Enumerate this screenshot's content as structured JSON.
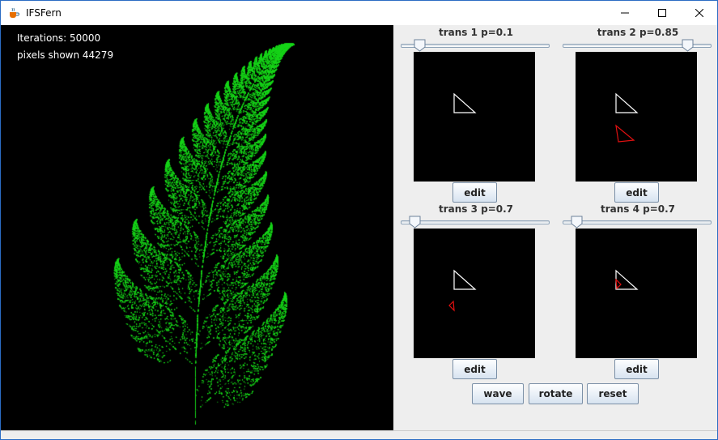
{
  "window": {
    "title": "IFSFern",
    "controls": {
      "minimize_icon": "minimize-icon",
      "maximize_icon": "maximize-icon",
      "close_icon": "close-icon"
    }
  },
  "canvas": {
    "iterations_text": "Iterations: 50000",
    "pixels_text": "pixels shown 44279",
    "fern_color": "#18d41a",
    "background": "#000000"
  },
  "transforms": [
    {
      "label": "trans 1 p=0.1",
      "slider_value": 0.1,
      "edit_label": "edit"
    },
    {
      "label": "trans 2 p=0.85",
      "slider_value": 0.85,
      "edit_label": "edit"
    },
    {
      "label": "trans 3 p=0.7",
      "slider_value": 0.07,
      "edit_label": "edit"
    },
    {
      "label": "trans 4 p=0.7",
      "slider_value": 0.07,
      "edit_label": "edit"
    }
  ],
  "actions": {
    "wave_label": "wave",
    "rotate_label": "rotate",
    "reset_label": "reset"
  },
  "colors": {
    "unit_triangle": "#ffffff",
    "transformed_triangle": "#e01010",
    "panel_bg": "#eeeeee"
  }
}
